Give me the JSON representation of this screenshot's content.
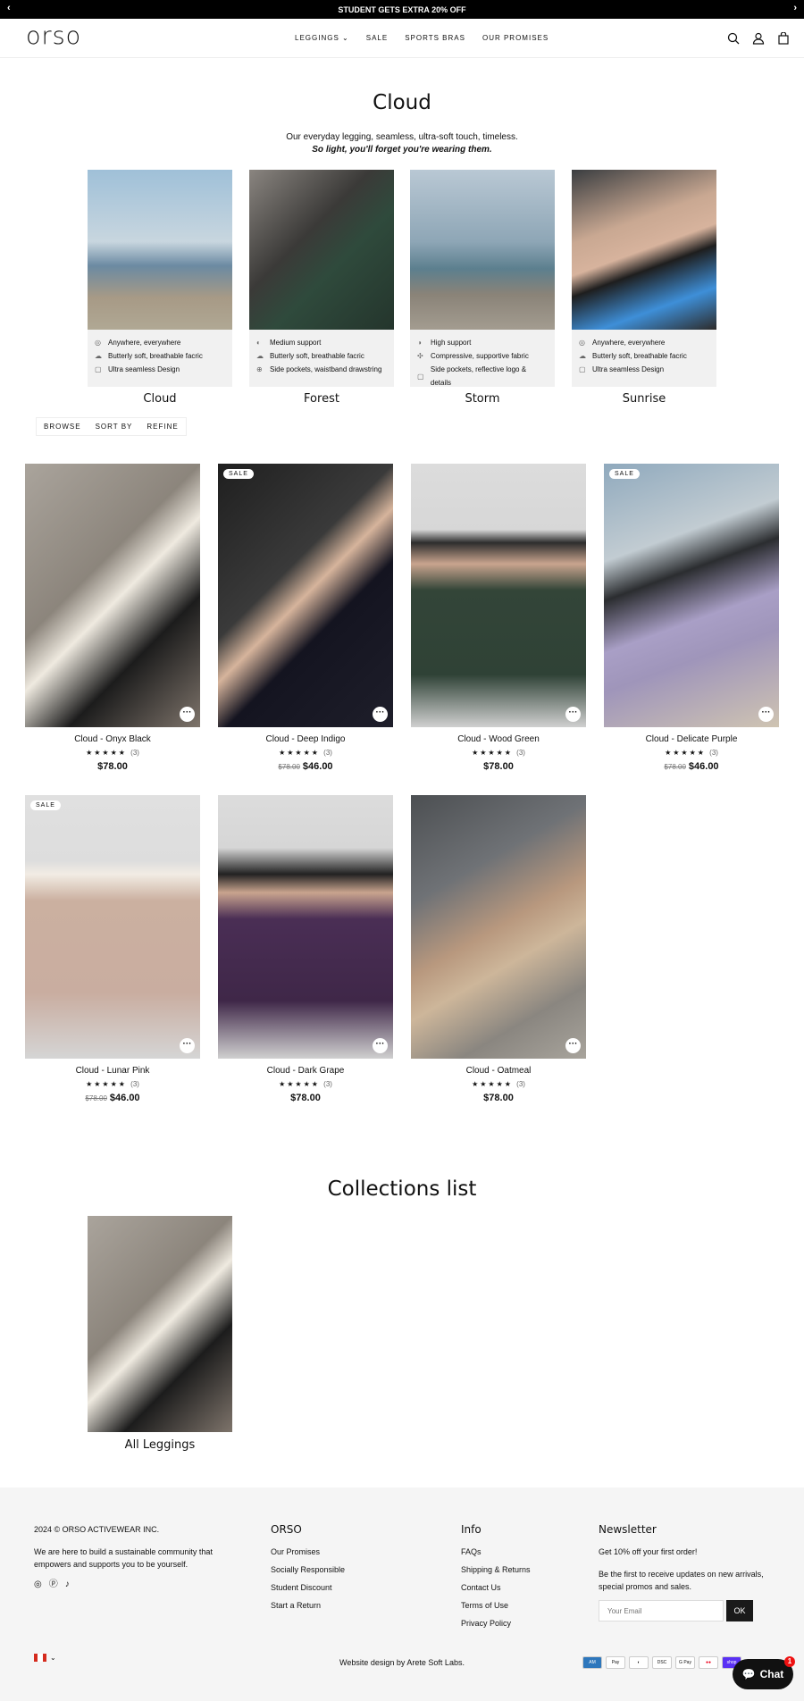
{
  "announcement": "STUDENT GETS EXTRA 20% OFF",
  "logo": "orso",
  "nav": [
    "LEGGINGS",
    "SALE",
    "SPORTS BRAS",
    "OUR PROMISES"
  ],
  "title": "Cloud",
  "desc1": "Our everyday legging, seamless, ultra-soft touch, timeless.",
  "desc2": "So light, you'll forget you're wearing them.",
  "variants": [
    {
      "name": "Cloud",
      "f": [
        "Anywhere, everywhere",
        "Butterly soft, breathable facric",
        "Ultra seamless Design"
      ]
    },
    {
      "name": "Forest",
      "f": [
        "Medium support",
        "Butterly soft, breathable facric",
        "Side pockets, waistband drawstring"
      ]
    },
    {
      "name": "Storm",
      "f": [
        "High support",
        "Compressive, supportive fabric",
        "Side pockets, reflective logo & details"
      ]
    },
    {
      "name": "Sunrise",
      "f": [
        "Anywhere, everywhere",
        "Butterly soft, breathable facric",
        "Ultra seamless Design"
      ]
    }
  ],
  "filters": [
    "BROWSE",
    "SORT BY",
    "REFINE"
  ],
  "products": [
    {
      "name": "Cloud - Onyx Black",
      "rating": "(3)",
      "old": "",
      "price": "$78.00",
      "sale": ""
    },
    {
      "name": "Cloud - Deep Indigo",
      "rating": "(3)",
      "old": "$78.00",
      "price": "$46.00",
      "sale": "SALE"
    },
    {
      "name": "Cloud - Wood Green",
      "rating": "(3)",
      "old": "",
      "price": "$78.00",
      "sale": ""
    },
    {
      "name": "Cloud - Delicate Purple",
      "rating": "(3)",
      "old": "$78.00",
      "price": "$46.00",
      "sale": "SALE"
    },
    {
      "name": "Cloud - Lunar Pink",
      "rating": "(3)",
      "old": "$78.00",
      "price": "$46.00",
      "sale": "SALE"
    },
    {
      "name": "Cloud - Dark Grape",
      "rating": "(3)",
      "old": "",
      "price": "$78.00",
      "sale": ""
    },
    {
      "name": "Cloud - Oatmeal",
      "rating": "(3)",
      "old": "",
      "price": "$78.00",
      "sale": ""
    }
  ],
  "collections_title": "Collections list",
  "collection": "All Leggings",
  "footer": {
    "copy": "2024 © ORSO ACTIVEWEAR INC.",
    "about": "We are here to build a sustainable community that empowers and supports you to be yourself.",
    "orso_title": "ORSO",
    "orso_links": [
      "Our Promises",
      "Socially Responsible",
      "Student Discount",
      "Start a Return"
    ],
    "info_title": "Info",
    "info_links": [
      "FAQs",
      "Shipping & Returns",
      "Contact Us",
      "Terms of Use",
      "Privacy Policy"
    ],
    "news_title": "Newsletter",
    "news1": "Get 10% off your first order!",
    "news2": "Be the first to receive updates on new arrivals, special promos and sales.",
    "email_placeholder": "Your Email",
    "ok": "OK",
    "credit": "Website design by Arete Soft Labs.",
    "chat": "Chat",
    "chat_count": "1"
  }
}
